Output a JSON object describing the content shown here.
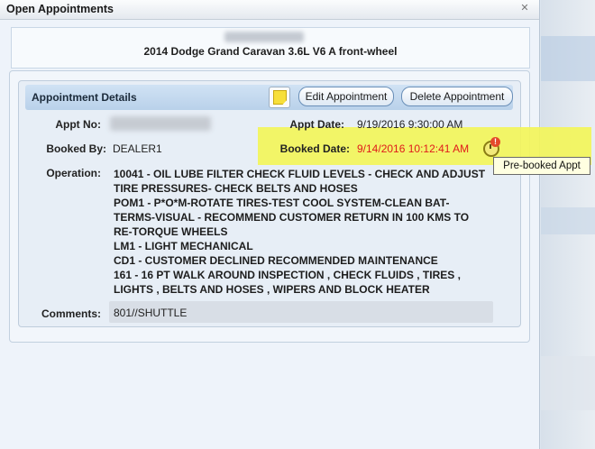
{
  "window": {
    "title": "Open Appointments",
    "close_icon": "close-icon"
  },
  "header": {
    "vehicle": "2014 Dodge Grand Caravan  3.6L V6 A front-wheel"
  },
  "details": {
    "title": "Appointment Details",
    "note_icon": "sticky-note-icon",
    "edit_label": "Edit Appointment",
    "delete_label": "Delete Appointment",
    "appt_no_label": "Appt No:",
    "appt_date_label": "Appt Date:",
    "appt_date_value": "9/19/2016 9:30:00 AM",
    "booked_by_label": "Booked By:",
    "booked_by_value": "DEALER1",
    "booked_date_label": "Booked Date:",
    "booked_date_value": "9/14/2016 10:12:41 AM",
    "booked_date_color": "#e01b1b",
    "prebooked_icon": "clock-alert-icon",
    "tooltip": "Pre-booked Appt",
    "operation_label": "Operation:",
    "operation_lines": [
      "10041 - OIL LUBE FILTER CHECK FLUID LEVELS - CHECK AND ADJUST",
      "TIRE PRESSURES- CHECK BELTS AND HOSES",
      "POM1 - P*O*M-ROTATE TIRES-TEST COOL SYSTEM-CLEAN BAT-",
      "TERMS-VISUAL - RECOMMEND CUSTOMER RETURN IN 100 KMS TO",
      "RE-TORQUE WHEELS",
      "LM1 - LIGHT MECHANICAL",
      "CD1 - CUSTOMER DECLINED RECOMMENDED MAINTENANCE",
      "161 - 16 PT WALK AROUND INSPECTION , CHECK FLUIDS , TIRES ,",
      "LIGHTS , BELTS AND HOSES , WIPERS AND BLOCK HEATER"
    ],
    "comments_label": "Comments:",
    "comments_value": "801//SHUTTLE"
  },
  "colors": {
    "highlight": "#f3f55a",
    "header_gradient": "#c3d9ef"
  }
}
